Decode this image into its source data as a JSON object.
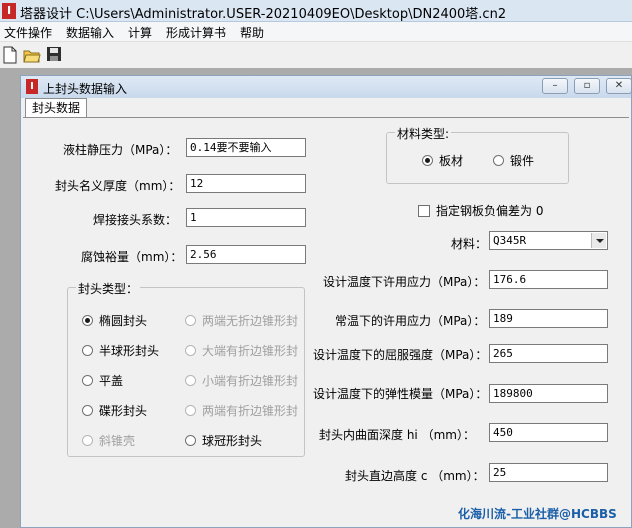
{
  "app": {
    "title": "塔器设计 C:\\Users\\Administrator.USER-20210409EO\\Desktop\\DN2400塔.cn2",
    "icon_letter": "I"
  },
  "menu": [
    "文件操作",
    "数据输入",
    "计算",
    "形成计算书",
    "帮助"
  ],
  "toolbar": {
    "icons": [
      "new-file-icon",
      "open-folder-icon",
      "save-icon"
    ]
  },
  "child_window": {
    "title": "上封头数据输入",
    "controls": {
      "minimize": "–",
      "restore": "▫",
      "close": "✕"
    }
  },
  "tab": {
    "label": "封头数据"
  },
  "left_fields": [
    {
      "label": "液柱静压力（MPa）：",
      "value": "0.14要不要输入"
    },
    {
      "label": "封头名义厚度（mm）：",
      "value": "12"
    },
    {
      "label": "焊接接头系数：",
      "value": "1"
    },
    {
      "label": "腐蚀裕量（mm）：",
      "value": "2.56"
    }
  ],
  "head_type": {
    "caption": "封头类型：",
    "options": [
      {
        "label": "椭圆封头",
        "selected": true,
        "enabled": true
      },
      {
        "label": "两端无折边锥形封",
        "selected": false,
        "enabled": false
      },
      {
        "label": "半球形封头",
        "selected": false,
        "enabled": true
      },
      {
        "label": "大端有折边锥形封",
        "selected": false,
        "enabled": false
      },
      {
        "label": "平盖",
        "selected": false,
        "enabled": true
      },
      {
        "label": "小端有折边锥形封",
        "selected": false,
        "enabled": false
      },
      {
        "label": "碟形封头",
        "selected": false,
        "enabled": true
      },
      {
        "label": "两端有折边锥形封",
        "selected": false,
        "enabled": false
      },
      {
        "label": "斜锥壳",
        "selected": false,
        "enabled": false
      },
      {
        "label": "球冠形封头",
        "selected": false,
        "enabled": true
      }
    ]
  },
  "material_type": {
    "caption": "材料类型:",
    "options": [
      {
        "label": "板材",
        "selected": true
      },
      {
        "label": "锻件",
        "selected": false
      }
    ]
  },
  "steel_tolerance": {
    "label": "指定钢板负偏差为 0",
    "checked": false
  },
  "material": {
    "label": "材料：",
    "value": "Q345R"
  },
  "right_fields": [
    {
      "label": "设计温度下许用应力（MPa）：",
      "value": "176.6"
    },
    {
      "label": "常温下的许用应力（MPa）：",
      "value": "189"
    },
    {
      "label": "设计温度下的屈服强度（MPa）：",
      "value": "265"
    },
    {
      "label": "设计温度下的弹性模量（MPa）：",
      "value": "189800"
    },
    {
      "label": "封头内曲面深度 hi （mm）：",
      "value": "450"
    },
    {
      "label": "封头直边高度 c （mm）：",
      "value": "25"
    }
  ],
  "watermark": "化海川流-工业社群@HCBBS"
}
